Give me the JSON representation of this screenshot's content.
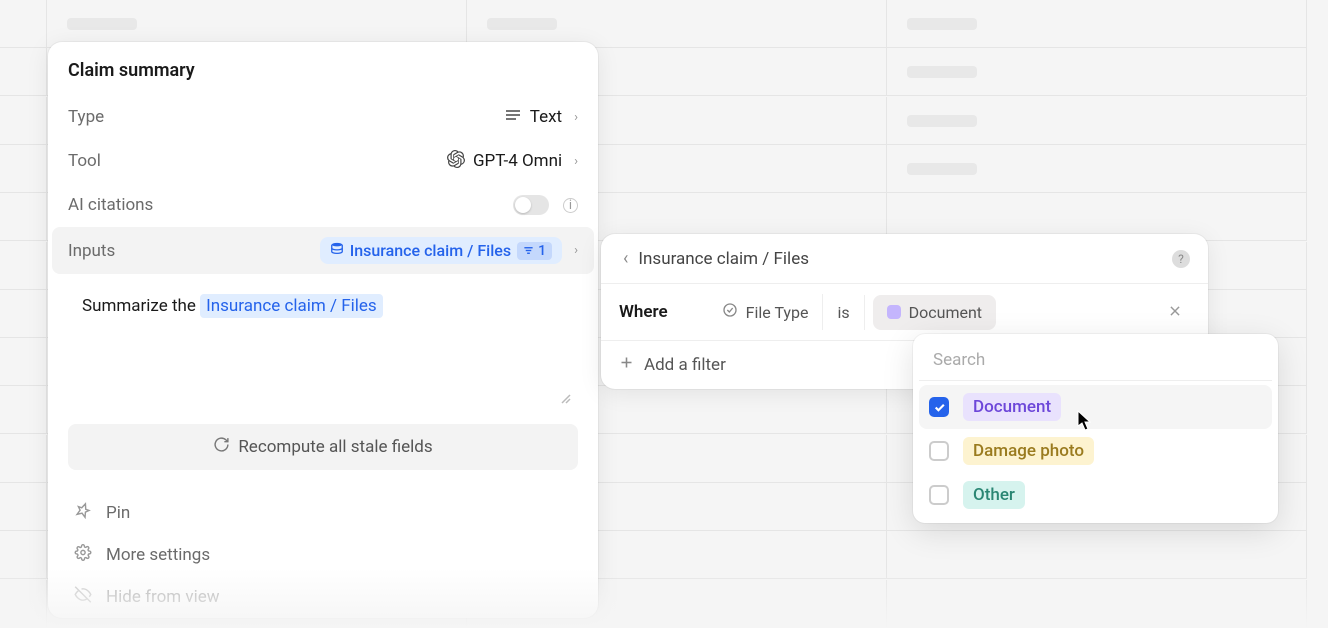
{
  "panel": {
    "title": "Claim summary",
    "rows": {
      "type_label": "Type",
      "type_value": "Text",
      "tool_label": "Tool",
      "tool_value": "GPT-4 Omni",
      "ai_citations_label": "AI citations",
      "inputs_label": "Inputs",
      "inputs_pill": "Insurance claim / Files",
      "inputs_count": "1"
    },
    "prompt_prefix": "Summarize the ",
    "prompt_mention": "Insurance claim / Files",
    "recompute_label": "Recompute all stale fields",
    "menu": {
      "pin": "Pin",
      "more": "More settings",
      "hide": "Hide from view"
    }
  },
  "filter": {
    "breadcrumb": "Insurance claim / Files",
    "where": "Where",
    "field": "File Type",
    "operator": "is",
    "value": "Document",
    "add_filter": "Add a filter"
  },
  "dropdown": {
    "search_placeholder": "Search",
    "options": [
      {
        "label": "Document",
        "checked": true,
        "tag_class": "tag-purple"
      },
      {
        "label": "Damage photo",
        "checked": false,
        "tag_class": "tag-yellow"
      },
      {
        "label": "Other",
        "checked": false,
        "tag_class": "tag-teal"
      }
    ]
  }
}
